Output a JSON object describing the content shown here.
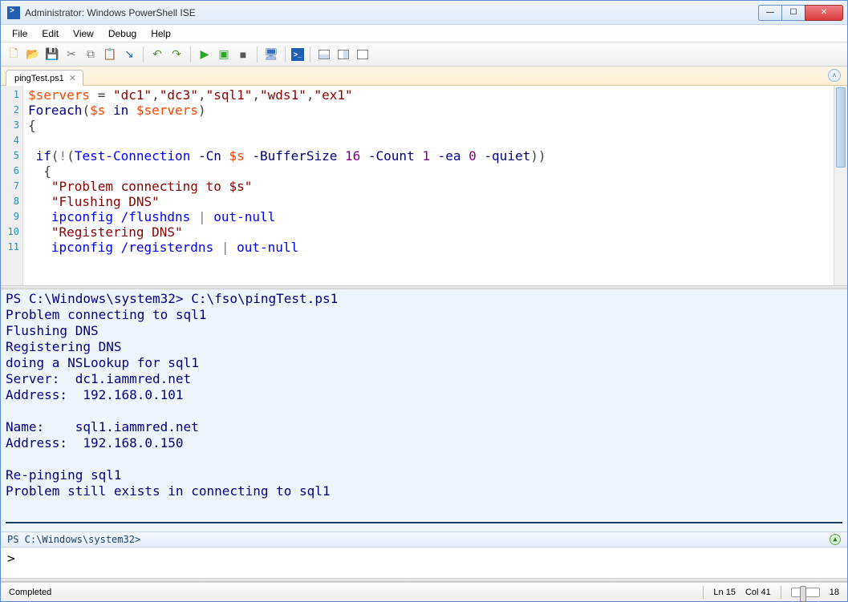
{
  "window": {
    "title": "Administrator: Windows PowerShell ISE"
  },
  "menu": {
    "file": "File",
    "edit": "Edit",
    "view": "View",
    "debug": "Debug",
    "help": "Help"
  },
  "tab": {
    "label": "pingTest.ps1"
  },
  "gutter": [
    "1",
    "2",
    "3",
    "4",
    "5",
    "6",
    "7",
    "8",
    "9",
    "10",
    "11"
  ],
  "code": {
    "l1_var": "$servers",
    "l1_eq": " = ",
    "l1_s1": "\"dc1\"",
    "l1_c1": ",",
    "l1_s2": "\"dc3\"",
    "l1_c2": ",",
    "l1_s3": "\"sql1\"",
    "l1_c3": ",",
    "l1_s4": "\"wds1\"",
    "l1_c4": ",",
    "l1_s5": "\"ex1\"",
    "l2_kw": "Foreach",
    "l2_op1": "(",
    "l2_var": "$s",
    "l2_in": " in ",
    "l2_var2": "$servers",
    "l2_op2": ")",
    "l3": "{",
    "l5_if": " if",
    "l5_o1": "(",
    "l5_bang": "!",
    "l5_o2": "(",
    "l5_cmd": "Test-Connection",
    "l5_p1": " -Cn ",
    "l5_v": "$s",
    "l5_p2": " -BufferSize ",
    "l5_n1": "16",
    "l5_p3": " -Count ",
    "l5_n2": "1",
    "l5_p4": " -ea ",
    "l5_n3": "0",
    "l5_p5": " -quiet",
    "l5_o3": "))",
    "l6": "  {",
    "l7": "   \"Problem connecting to $s\"",
    "l8": "   \"Flushing DNS\"",
    "l9_pre": "   ",
    "l9_cmd": "ipconfig",
    "l9_arg": " /flushdns ",
    "l9_pipe": "|",
    "l9_out": " out-null",
    "l10": "   \"Registering DNS\"",
    "l11_pre": "   ",
    "l11_cmd": "ipconfig",
    "l11_arg": " /registerdns ",
    "l11_pipe": "|",
    "l11_out": " out-null"
  },
  "output": "PS C:\\Windows\\system32> C:\\fso\\pingTest.ps1\nProblem connecting to sql1\nFlushing DNS\nRegistering DNS\ndoing a NSLookup for sql1\nServer:  dc1.iammred.net\nAddress:  192.168.0.101\n\nName:    sql1.iammred.net\nAddress:  192.168.0.150\n\nRe-pinging sql1\nProblem still exists in connecting to sql1\n",
  "cmdprompt": "PS C:\\Windows\\system32>",
  "cmdinput": ">",
  "status": {
    "left": "Completed",
    "ln": "Ln 15",
    "col": "Col 41",
    "zoom": "18"
  }
}
